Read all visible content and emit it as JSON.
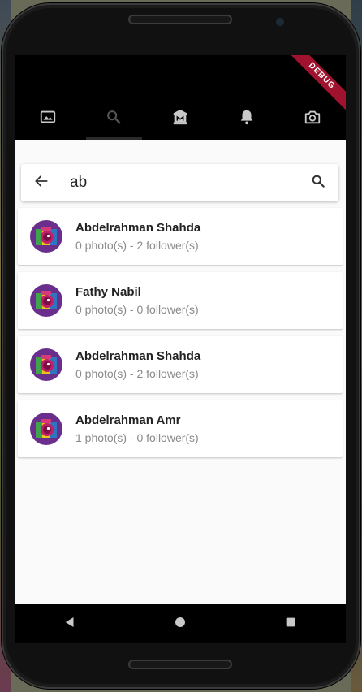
{
  "tabs": [
    {
      "name": "gallery",
      "icon": "image-icon",
      "active": false
    },
    {
      "name": "search",
      "icon": "search-icon",
      "active": true
    },
    {
      "name": "museum",
      "icon": "museum-icon",
      "active": false
    },
    {
      "name": "notifications",
      "icon": "bell-icon",
      "active": false
    },
    {
      "name": "camera",
      "icon": "camera-icon",
      "active": false
    }
  ],
  "debug_banner": "DEBUG",
  "search": {
    "query": "ab",
    "back_icon": "arrow-back-icon",
    "search_icon": "search-icon"
  },
  "results": [
    {
      "name": "Abdelrahman Shahda",
      "meta": "0 photo(s) - 2 follower(s)",
      "avatar": "camera-logo-avatar"
    },
    {
      "name": "Fathy Nabil",
      "meta": "0 photo(s) - 0 follower(s)",
      "avatar": "camera-logo-avatar"
    },
    {
      "name": "Abdelrahman Shahda",
      "meta": "0 photo(s) - 2 follower(s)",
      "avatar": "camera-logo-avatar"
    },
    {
      "name": "Abdelrahman Amr",
      "meta": "1 photo(s) - 0 follower(s)",
      "avatar": "camera-logo-avatar"
    }
  ],
  "navbar": [
    {
      "name": "back",
      "icon": "triangle-back-icon"
    },
    {
      "name": "home",
      "icon": "circle-home-icon"
    },
    {
      "name": "recents",
      "icon": "square-recents-icon"
    }
  ],
  "colors": {
    "icon_inactive": "#c9c9c9",
    "icon_active": "#555555",
    "tab_indicator": "#2b2b2b",
    "debug_ribbon": "#a0122e",
    "name_text": "#222222",
    "meta_text": "#8a8a8a"
  }
}
